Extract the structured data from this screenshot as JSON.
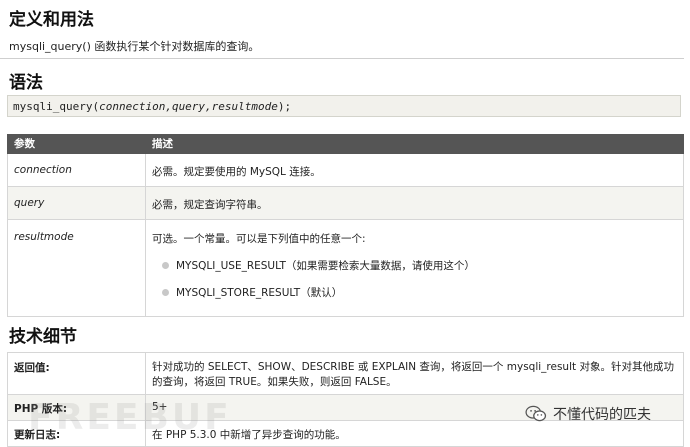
{
  "section1": {
    "title": "定义和用法",
    "intro": "mysqli_query() 函数执行某个针对数据库的查询。"
  },
  "section2": {
    "title": "语法",
    "code": {
      "fn": "mysqli_query(",
      "args": "connection,query,resultmode",
      "end": ");"
    }
  },
  "param_table": {
    "headers": [
      "参数",
      "描述"
    ],
    "rows": [
      {
        "name": "connection",
        "desc": "必需。规定要使用的 MySQL 连接。"
      },
      {
        "name": "query",
        "desc": "必需，规定查询字符串。"
      },
      {
        "name": "resultmode",
        "desc": "可选。一个常量。可以是下列值中的任意一个:",
        "options": [
          "MYSQLI_USE_RESULT（如果需要检索大量数据，请使用这个）",
          "MYSQLI_STORE_RESULT（默认）"
        ]
      }
    ]
  },
  "section3": {
    "title": "技术细节"
  },
  "tech_table": {
    "rows": [
      {
        "name": "返回值:",
        "desc": "针对成功的 SELECT、SHOW、DESCRIBE 或 EXPLAIN 查询，将返回一个 mysqli_result 对象。针对其他成功的查询，将返回 TRUE。如果失败，则返回 FALSE。"
      },
      {
        "name": "PHP 版本:",
        "desc": "5+"
      },
      {
        "name": "更新日志:",
        "desc": "在 PHP 5.3.0 中新增了异步查询的功能。"
      }
    ]
  },
  "watermark": {
    "text": "FREEBUF",
    "account": "不懂代码的匹夫",
    "icon": "wechat-icon"
  }
}
